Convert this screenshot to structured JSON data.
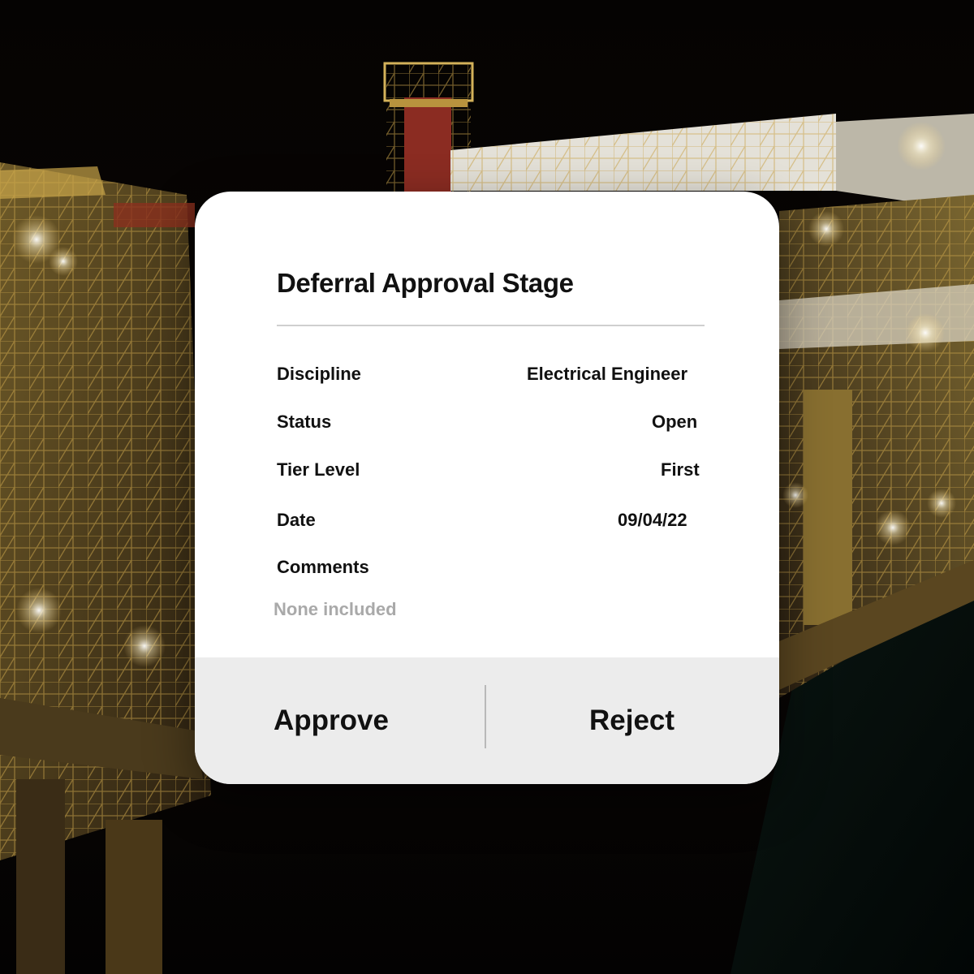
{
  "card": {
    "title": "Deferral Approval Stage",
    "fields": [
      {
        "label": "Discipline",
        "value": "Electrical Engineer"
      },
      {
        "label": "Status",
        "value": "Open"
      },
      {
        "label": "Tier Level",
        "value": "First"
      },
      {
        "label": "Date",
        "value": "09/04/22"
      }
    ],
    "comments": {
      "label": "Comments",
      "value": "None included"
    }
  },
  "actions": {
    "approve_label": "Approve",
    "reject_label": "Reject"
  },
  "colors": {
    "card_bg": "#ffffff",
    "action_bar_bg": "#ececec",
    "text": "#111111",
    "muted_text": "#a9a9a9",
    "scaffold_yellow": "#d4a93a"
  },
  "background": {
    "icon": "offshore-platform-night-photo"
  }
}
